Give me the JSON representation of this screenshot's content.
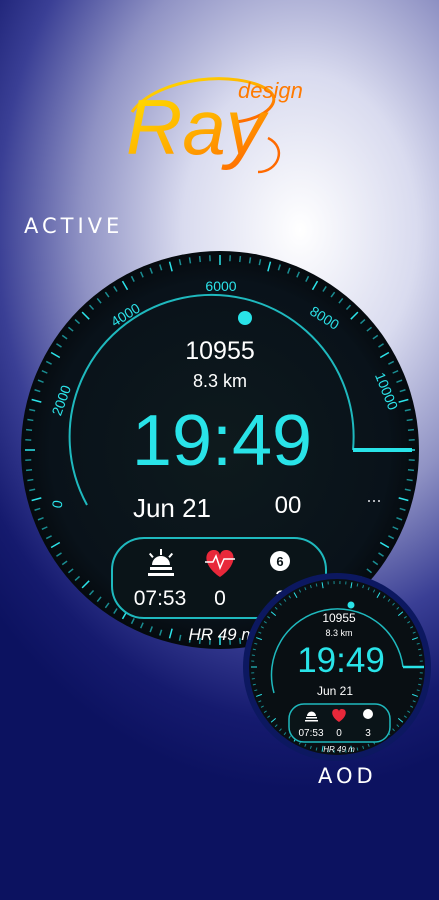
{
  "logo": {
    "script_text": "Ray",
    "small_text": "design"
  },
  "labels": {
    "active": "ACTIVE",
    "aod": "AOD"
  },
  "colors": {
    "accent": "#29e3e8",
    "heart": "#e8283a",
    "face_bg": "#0b1416"
  },
  "active_watch": {
    "ticks": [
      "0",
      "2000",
      "4000",
      "6000",
      "8000",
      "10000"
    ],
    "steps": "10955",
    "distance": "8.3 km",
    "time": "19:49",
    "date": "Jun 21",
    "seconds": "00",
    "dots": "...",
    "sunrise": "07:53",
    "heart_value": "0",
    "badge": "6",
    "third_value": "3",
    "hr": "HR 49 m"
  },
  "aod_watch": {
    "steps": "10955",
    "distance": "8.3 km",
    "time": "19:49",
    "date": "Jun 21",
    "sunrise": "07:53",
    "heart_value": "0",
    "third_value": "3",
    "hr": "HR 49 m"
  }
}
